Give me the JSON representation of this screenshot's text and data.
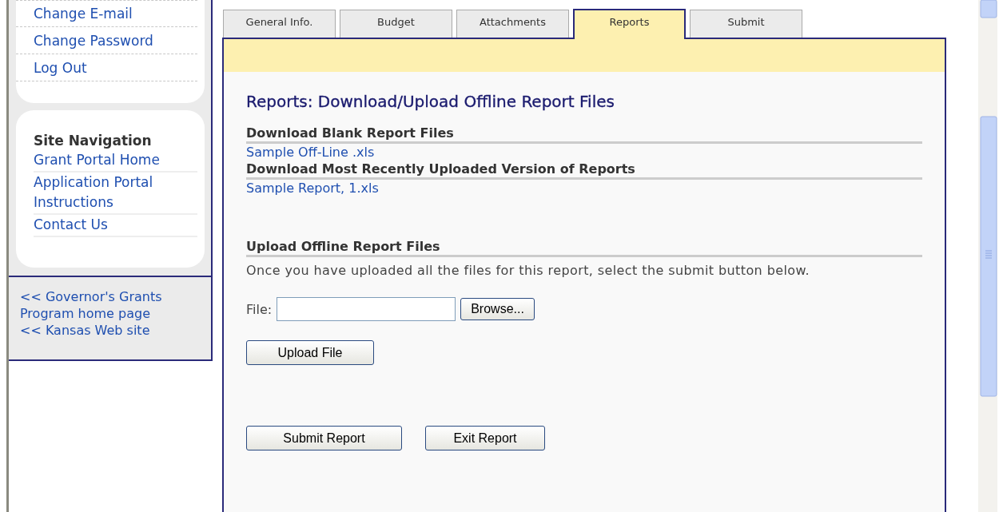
{
  "sidebar": {
    "account_links": [
      "Change E-mail",
      "Change Password",
      "Log Out"
    ],
    "navigation": {
      "heading": "Site Navigation",
      "links": [
        "Grant Portal Home",
        "Application Portal Instructions",
        "Contact Us"
      ]
    },
    "footer_links": [
      "<< Governor's Grants Program home page",
      "<< Kansas Web site"
    ]
  },
  "tabs": [
    {
      "label": "General Info.",
      "selected": false
    },
    {
      "label": "Budget",
      "selected": false
    },
    {
      "label": "Attachments",
      "selected": false
    },
    {
      "label": "Reports",
      "selected": true
    },
    {
      "label": "Submit",
      "selected": false
    }
  ],
  "panel": {
    "title": "Reports: Download/Upload Offline Report Files",
    "sections": [
      {
        "heading": "Download Blank Report Files",
        "links": [
          "Sample Off-Line .xls"
        ]
      },
      {
        "heading": "Download Most Recently Uploaded Version of Reports",
        "links": [
          "Sample Report, 1.xls"
        ]
      }
    ],
    "upload": {
      "heading": "Upload Offline Report Files",
      "instructions": "Once you have uploaded all the files for this report, select the submit button below.",
      "file_label": "File:",
      "browse_button": "Browse...",
      "upload_button": "Upload File"
    },
    "buttons": [
      "Submit Report",
      "Exit Report"
    ]
  }
}
